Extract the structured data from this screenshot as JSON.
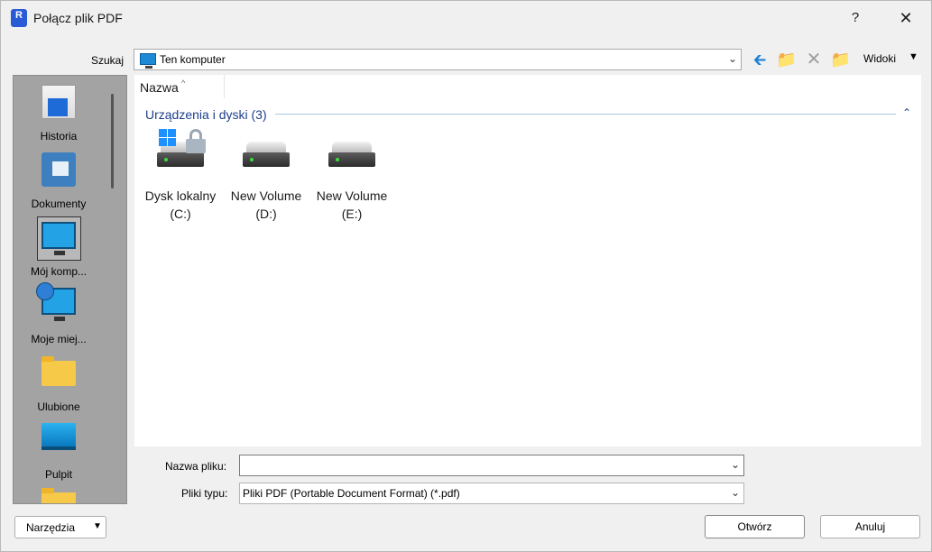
{
  "window": {
    "title": "Połącz plik PDF",
    "app_icon_letter": "R",
    "help_label": "?",
    "close_label": "✕"
  },
  "toolbar": {
    "lookin_label": "Szukaj",
    "lookin_value": "Ten komputer",
    "views_label": "Widoki",
    "back_icon": "back-arrow-icon",
    "up_icon": "folder-up-icon",
    "delete_icon": "delete-icon",
    "new_folder_icon": "new-folder-icon"
  },
  "places": [
    {
      "label": "Historia",
      "icon": "history-icon"
    },
    {
      "label": "Dokumenty",
      "icon": "documents-icon"
    },
    {
      "label": "Mój komp...",
      "icon": "computer-icon",
      "selected": true
    },
    {
      "label": "Moje miej...",
      "icon": "network-places-icon"
    },
    {
      "label": "Ulubione",
      "icon": "favorites-folder-icon"
    },
    {
      "label": "Pulpit",
      "icon": "desktop-icon"
    }
  ],
  "filelist": {
    "column_name": "Nazwa",
    "group_title": "Urządzenia i dyski (3)",
    "drives": [
      {
        "line1": "Dysk lokalny",
        "line2": "(C:)",
        "icon": "local-disk-icon"
      },
      {
        "line1": "New Volume",
        "line2": "(D:)",
        "icon": "drive-icon"
      },
      {
        "line1": "New Volume",
        "line2": "(E:)",
        "icon": "drive-icon"
      }
    ]
  },
  "form": {
    "filename_label": "Nazwa pliku:",
    "filename_value": "",
    "filetype_label": "Pliki typu:",
    "filetype_value": "Pliki PDF (Portable Document Format) (*.pdf)"
  },
  "buttons": {
    "tools_label": "Narzędzia",
    "open_label": "Otwórz",
    "cancel_label": "Anuluj"
  },
  "colors": {
    "accent": "#1d7fd6",
    "group_title": "#1e3f8c",
    "places_bg": "#a3a3a3"
  }
}
